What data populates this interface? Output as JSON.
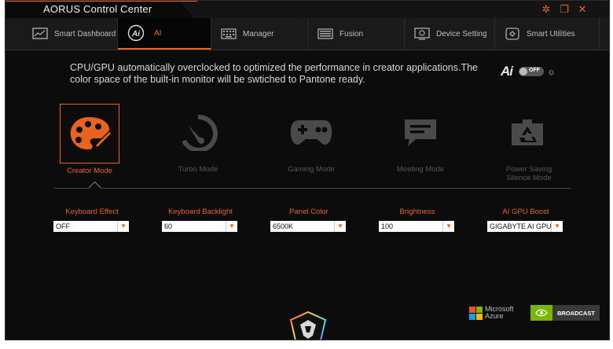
{
  "app": {
    "title": "AORUS Control Center"
  },
  "colors": {
    "accent": "#e8641e",
    "background": "#0c0c0c",
    "nav": "#1a1a1a",
    "inactive": "#555555"
  },
  "window_controls": [
    {
      "name": "settings",
      "icon": "gear-icon",
      "glyph": "✲"
    },
    {
      "name": "restore",
      "icon": "restore-icon",
      "glyph": "❐"
    },
    {
      "name": "close",
      "icon": "close-icon",
      "glyph": "✕"
    }
  ],
  "tabs": [
    {
      "label": "Smart Dashboard",
      "icon": "dashboard-icon",
      "active": false
    },
    {
      "label": "AI",
      "icon": "ai-icon",
      "active": true
    },
    {
      "label": "Manager",
      "icon": "keyboard-icon",
      "active": false
    },
    {
      "label": "Fusion",
      "icon": "keyboard-rgb-icon",
      "active": false
    },
    {
      "label": "Device Setting",
      "icon": "device-icon",
      "active": false
    },
    {
      "label": "Smart Utilities",
      "icon": "utilities-icon",
      "active": false
    }
  ],
  "description": "CPU/GPU automatically overclocked to optimized the performance in creator applications.The color space of the built-in monitor will be swtiched to Pantone ready.",
  "ai_toggle": {
    "logo": "Ai",
    "state": "OFF",
    "icon": "sun-icon"
  },
  "modes": [
    {
      "label": "Creator Mode",
      "icon": "palette-icon",
      "active": true
    },
    {
      "label": "Turbo Mode",
      "icon": "speedometer-icon",
      "active": false
    },
    {
      "label": "Gaming Mode",
      "icon": "gamepad-icon",
      "active": false
    },
    {
      "label": "Meeting Mode",
      "icon": "chat-icon",
      "active": false
    },
    {
      "label": "Power Saving\nSilence Mode",
      "icon": "battery-recycle-icon",
      "active": false
    }
  ],
  "settings": [
    {
      "label": "Keyboard Effect",
      "value": "OFF"
    },
    {
      "label": "Keyboard Backlight",
      "value": "60"
    },
    {
      "label": "Panel Color",
      "value": "6500K"
    },
    {
      "label": "Brightness",
      "value": "100"
    },
    {
      "label": "AI GPU Boost",
      "value": "GIGABYTE AI GPU"
    }
  ],
  "branding": {
    "microsoft": [
      "Microsoft",
      "Azure"
    ],
    "nvidia_broadcast": "BROADCAST"
  }
}
